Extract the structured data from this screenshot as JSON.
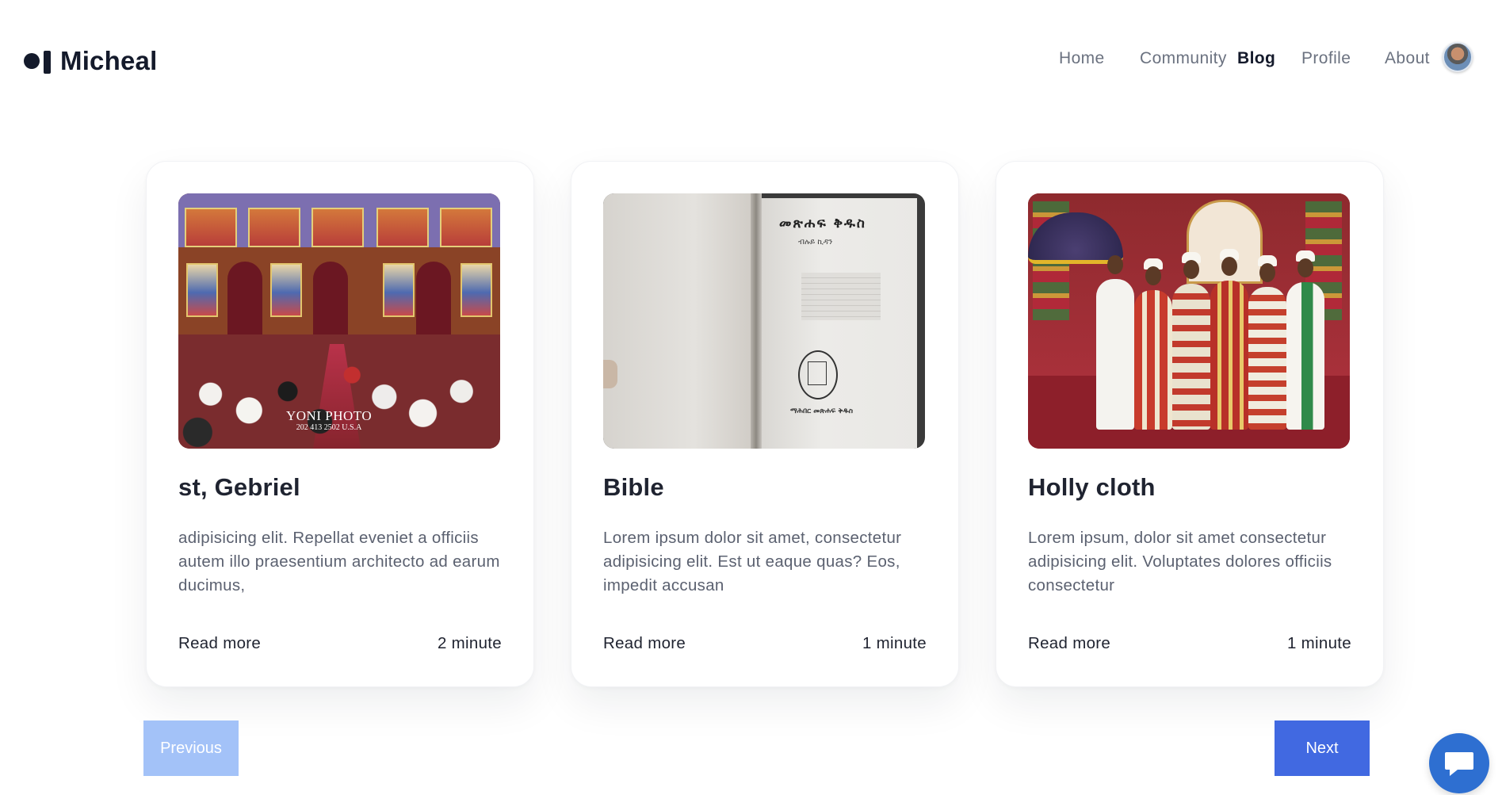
{
  "brand": {
    "name": "Micheal"
  },
  "nav": {
    "items": [
      {
        "label": "Home",
        "active": false
      },
      {
        "label": "Community",
        "active": false
      },
      {
        "label": "Blog",
        "active": true
      },
      {
        "label": "Profile",
        "active": false
      },
      {
        "label": "About",
        "active": false
      }
    ],
    "avatar_icon": "user-avatar"
  },
  "posts": [
    {
      "title": "st, Gebriel",
      "excerpt": "adipisicing elit. Repellat eveniet a officiis autem illo praesentium architecto ad earum ducimus,",
      "read_more": "Read more",
      "read_time": "2 minute",
      "image": {
        "subject": "church-interior",
        "watermark_line1": "YONI PHOTO",
        "watermark_line2": "202 413 2502  U.S.A"
      }
    },
    {
      "title": "Bible",
      "excerpt": "Lorem ipsum dolor sit amet, consectetur adipisicing elit. Est ut eaque quas? Eos, impedit accusan",
      "read_more": "Read more",
      "read_time": "1 minute",
      "image": {
        "subject": "open-bible",
        "page_title": "መጽሐፍ ቅዱስ",
        "page_subtitle": "ብሉይ ኪዳን",
        "publisher": "ማሕበር መጽሐፍ ቅዱስ"
      }
    },
    {
      "title": "Holly cloth",
      "excerpt": "Lorem ipsum, dolor sit amet consectetur adipisicing elit. Voluptates dolores officiis consectetur",
      "read_more": "Read more",
      "read_time": "1 minute",
      "image": {
        "subject": "priests-in-vestments"
      }
    }
  ],
  "pagination": {
    "previous": "Previous",
    "next": "Next",
    "previous_disabled": true
  },
  "chat": {
    "icon": "chat-bubble-icon"
  },
  "colors": {
    "accent": "#4169e1",
    "accent_disabled": "#a3c2f8",
    "chat": "#2e6fd1",
    "heading": "#1f2330",
    "muted": "#6b7280"
  }
}
